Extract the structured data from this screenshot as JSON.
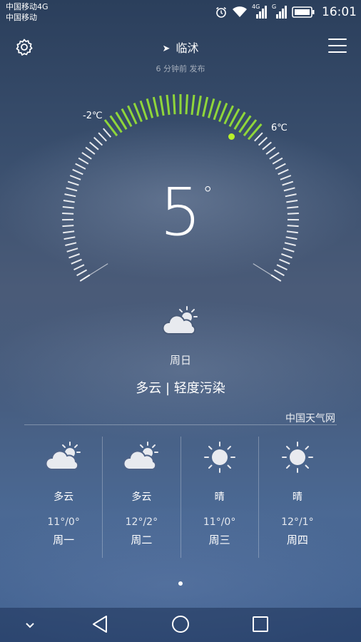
{
  "status_bar": {
    "carrier_line1": "中国移动4G",
    "carrier_line2": "中国移动",
    "sim1_network": "4G",
    "sim2_network": "G",
    "time": "16:01"
  },
  "header": {
    "location": "临沭",
    "published": "6 分钟前 发布"
  },
  "current": {
    "temp_min_label": "-2℃",
    "temp_max_label": "6℃",
    "temp_min": -2,
    "temp_max": 6,
    "temperature": "5",
    "degree_symbol": "°",
    "weather_icon": "partly-cloudy-icon",
    "day": "周日",
    "condition": "多云 | 轻度污染"
  },
  "source": "中国天气网",
  "forecast": [
    {
      "icon": "partly-cloudy-icon",
      "condition": "多云",
      "range": "11°/0°",
      "day": "周一"
    },
    {
      "icon": "partly-cloudy-icon",
      "condition": "多云",
      "range": "12°/2°",
      "day": "周二"
    },
    {
      "icon": "sunny-icon",
      "condition": "晴",
      "range": "11°/0°",
      "day": "周三"
    },
    {
      "icon": "sunny-icon",
      "condition": "晴",
      "range": "12°/1°",
      "day": "周四"
    }
  ],
  "colors": {
    "accent": "#8fd63a",
    "current_dot": "#b8f02a"
  }
}
